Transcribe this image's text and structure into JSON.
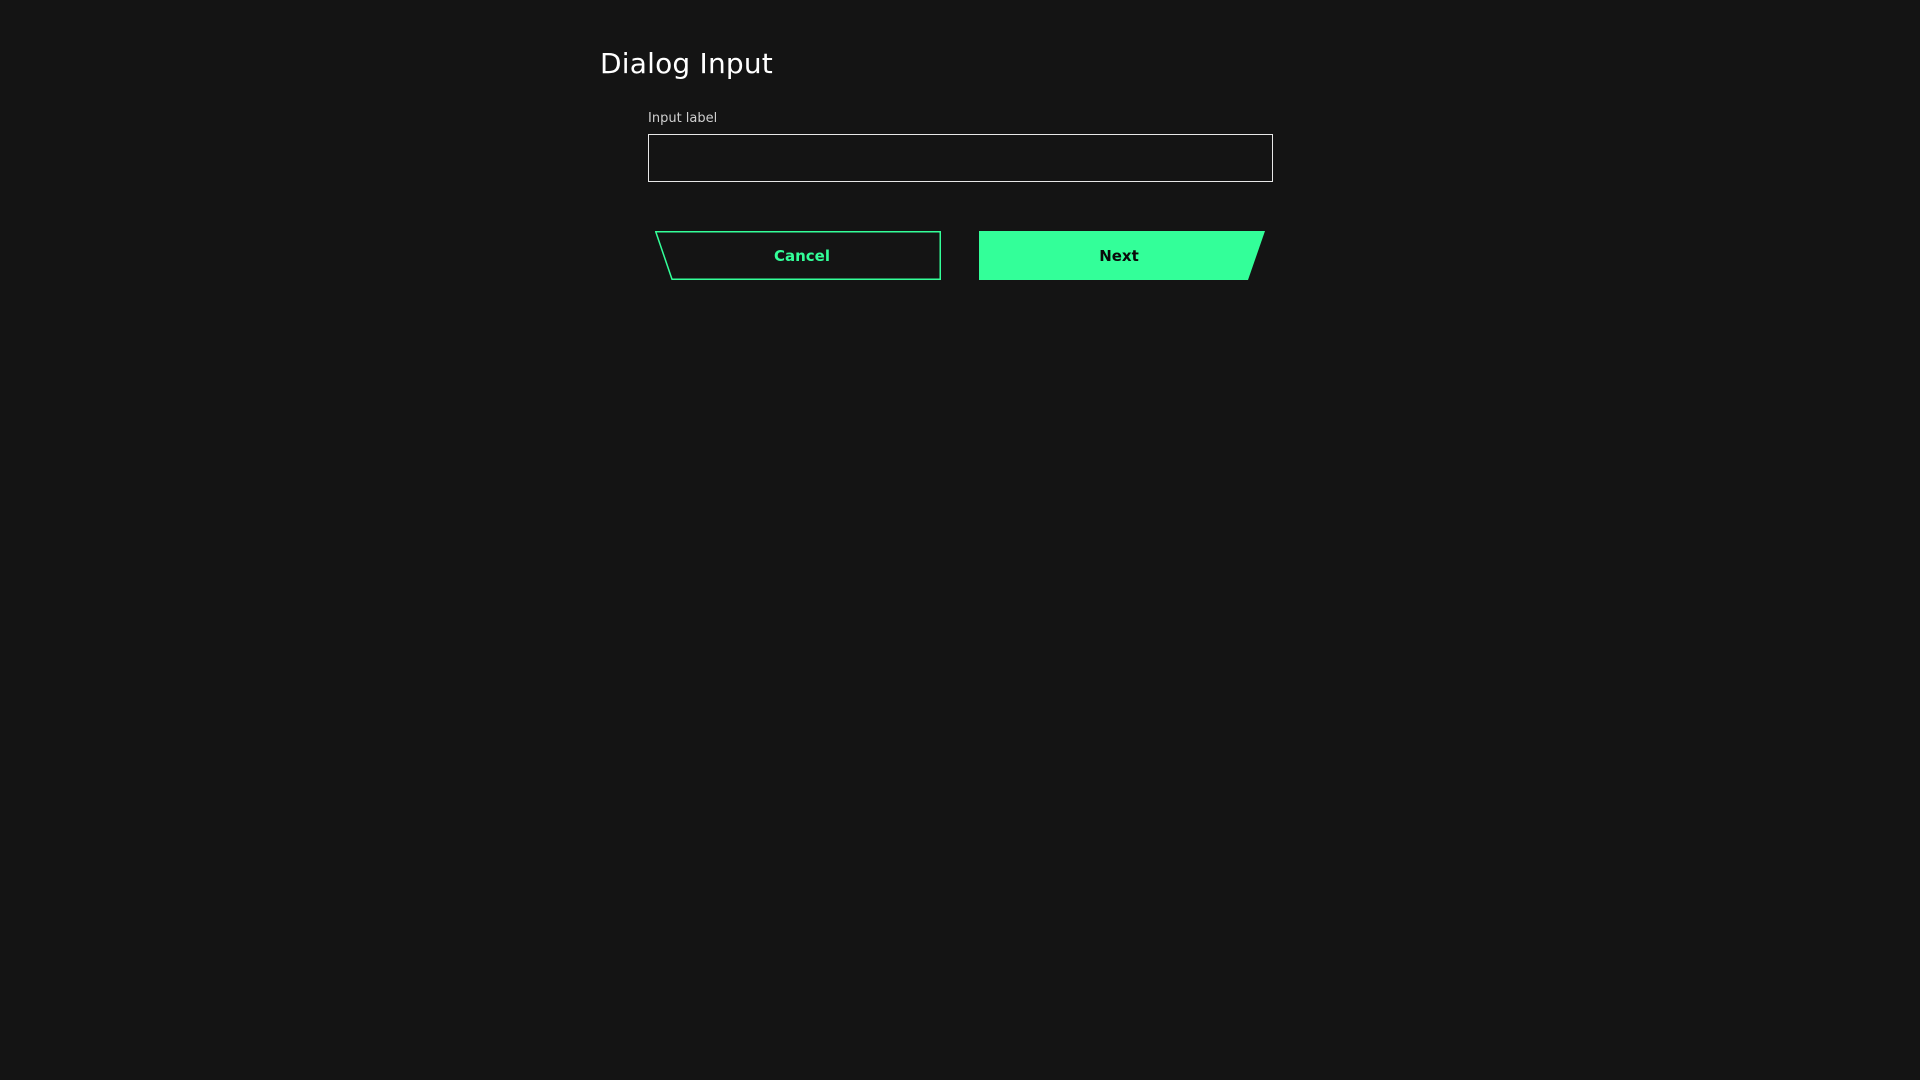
{
  "dialog": {
    "title": "Dialog Input"
  },
  "input": {
    "label": "Input label",
    "value": "",
    "placeholder": ""
  },
  "actions": {
    "cancel_label": "Cancel",
    "next_label": "Next"
  },
  "colors": {
    "background": "#141414",
    "accent": "#33ff99",
    "text_primary": "#ffffff",
    "text_secondary": "#cfcfcf",
    "input_border": "#e8e8e8"
  }
}
